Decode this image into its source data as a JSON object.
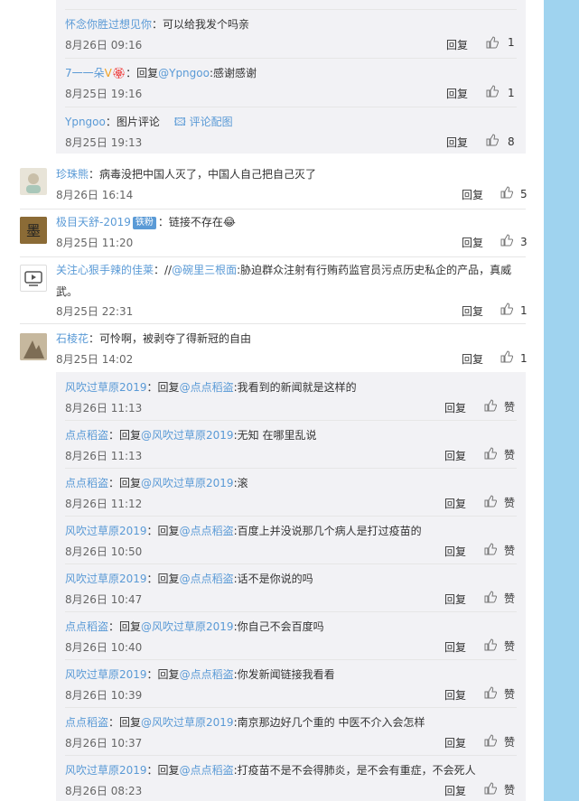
{
  "top_replies": [
    {
      "user": "怀念你胜过想见你",
      "text": "：可以给我发个吗亲",
      "time": "8月26日 09:16",
      "reply": "回复",
      "likes": "1"
    },
    {
      "user": "7一一朵",
      "text": "：回复",
      "mention": "@Ypngoo",
      "after": ":感谢感谢",
      "time": "8月25日 19:16",
      "reply": "回复",
      "likes": "1"
    },
    {
      "user": "Ypngoo",
      "text": "：图片评论",
      "extra": "评论配图",
      "time": "8月25日 19:13",
      "reply": "回复",
      "likes": "8"
    }
  ],
  "comments": [
    {
      "user": "珍珠熊",
      "text": "：病毒没把中国人灭了，中国人自己把自己灭了",
      "time": "8月26日 16:14",
      "reply": "回复",
      "likes": "5"
    },
    {
      "user": "极目天舒-2019",
      "badge": "铁粉",
      "text": "：链接不存在",
      "time": "8月25日 11:20",
      "reply": "回复",
      "likes": "3"
    },
    {
      "user": "关注心狠手辣的佳莱",
      "text": "：//",
      "mention": "@碗里三根面",
      "after": ":胁迫群众注射有行贿药监官员污点历史私企的产品，真威",
      "after2": "武。",
      "time": "8月25日 22:31",
      "reply": "回复",
      "likes": "1"
    },
    {
      "user": "石棱花",
      "text": "：可怜啊，被剥夺了得新冠的自由",
      "time": "8月25日 14:02",
      "reply": "回复",
      "likes": "1"
    }
  ],
  "sub_replies": [
    {
      "user": "风吹过草原2019",
      "mention": "@点点稻盗",
      "text": "我看到的新闻就是这样的",
      "time": "8月26日 11:13"
    },
    {
      "user": "点点稻盗",
      "mention": "@风吹过草原2019",
      "text": "无知 在哪里乱说",
      "time": "8月26日 11:13"
    },
    {
      "user": "点点稻盗",
      "mention": "@风吹过草原2019",
      "text": "滚",
      "time": "8月26日 11:12"
    },
    {
      "user": "风吹过草原2019",
      "mention": "@点点稻盗",
      "text": "百度上并没说那几个病人是打过疫苗的",
      "time": "8月26日 10:50"
    },
    {
      "user": "风吹过草原2019",
      "mention": "@点点稻盗",
      "text": "话不是你说的吗",
      "time": "8月26日 10:47"
    },
    {
      "user": "点点稻盗",
      "mention": "@风吹过草原2019",
      "text": "你自己不会百度吗",
      "time": "8月26日 10:40"
    },
    {
      "user": "风吹过草原2019",
      "mention": "@点点稻盗",
      "text": "你发新闻链接我看看",
      "time": "8月26日 10:39"
    },
    {
      "user": "点点稻盗",
      "mention": "@风吹过草原2019",
      "text": "南京那边好几个重的 中医不介入会怎样",
      "time": "8月26日 10:37"
    },
    {
      "user": "风吹过草原2019",
      "mention": "@点点稻盗",
      "text": "打疫苗不是不会得肺炎，是不会有重症，不会死人",
      "time": "8月26日 08:23"
    }
  ],
  "labels": {
    "reply": "回复",
    "reply_prefix": "：回复",
    "like_sub": "赞"
  },
  "colors": {
    "accent": "#eb7350",
    "link": "#5a9ad6",
    "panel": "#ffffff",
    "side": "#9fd3ef"
  }
}
